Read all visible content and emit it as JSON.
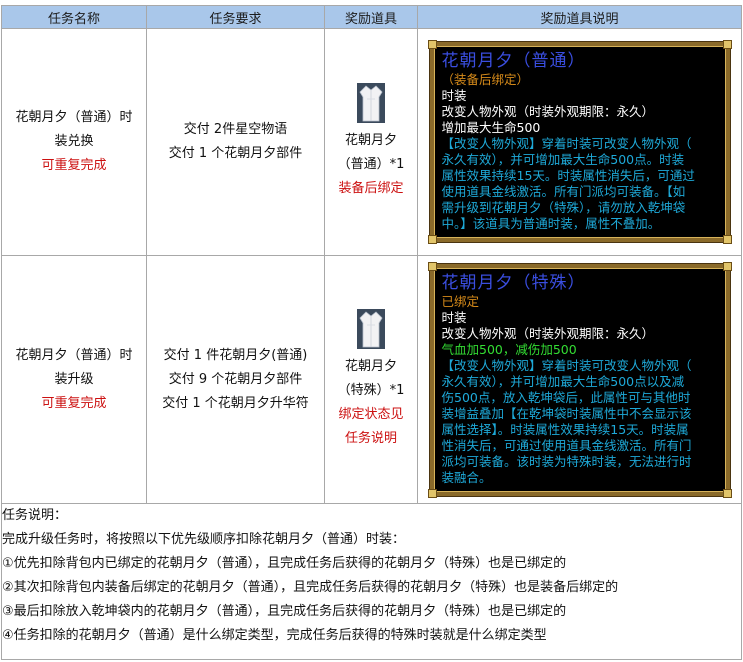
{
  "headers": [
    "任务名称",
    "任务要求",
    "奖励道具",
    "奖励道具说明"
  ],
  "rows": [
    {
      "name_lines": [
        "花朝月夕（普通）时",
        "装兑换"
      ],
      "repeat": "可重复完成",
      "requirements": [
        "交付 2件星空物语",
        "交付 1 个花朝月夕部件"
      ],
      "reward_lines": [
        "花朝月夕",
        "（普通）*1"
      ],
      "reward_bind": "装备后绑定",
      "tooltip": {
        "title": "花朝月夕（普通）",
        "bind": "（装备后绑定）",
        "white_lines": [
          "时装",
          "改变人物外观（时装外观期限：永久）",
          "增加最大生命500"
        ],
        "green_lines": [],
        "desc_lines": [
          "【改变人物外观】穿着时装可改变人物外观（",
          "永久有效），并可增加最大生命500点。时装",
          "属性效果持续15天。时装属性消失后，可通过",
          "使用道具金线激活。所有门派均可装备。【如",
          "需升级到花朝月夕（特殊），请勿放入乾坤袋",
          "中。】该道具为普通时装，属性不叠加。"
        ]
      }
    },
    {
      "name_lines": [
        "花朝月夕（普通）时",
        "装升级"
      ],
      "repeat": "可重复完成",
      "requirements": [
        "交付 1 件花朝月夕(普通)",
        "交付 9 个花朝月夕部件",
        "交付 1 个花朝月夕升华符"
      ],
      "reward_lines": [
        "花朝月夕",
        "（特殊）*1"
      ],
      "reward_bind": "绑定状态见任务说明",
      "reward_bind_lines": [
        "绑定状态见",
        "任务说明"
      ],
      "tooltip": {
        "title": "花朝月夕（特殊）",
        "bind": "已绑定",
        "white_lines": [
          "时装",
          "改变人物外观（时装外观期限：永久）"
        ],
        "green_lines": [
          "气血加500，减伤加500"
        ],
        "desc_lines": [
          "【改变人物外观】穿着时装可改变人物外观（",
          "永久有效），并可增加最大生命500点以及减",
          "伤500点，放入乾坤袋后，此属性可与其他时",
          "装增益叠加【在乾坤袋时装属性中不会显示该",
          "属性选择】。时装属性效果持续15天。时装属",
          "性消失后，可通过使用道具金线激活。所有门",
          "派均可装备。该时装为特殊时装，无法进行时",
          "装融合。"
        ]
      }
    }
  ],
  "note": {
    "title": "任务说明：",
    "lines": [
      "完成升级任务时，将按照以下优先级顺序扣除花朝月夕（普通）时装：",
      "①优先扣除背包内已绑定的花朝月夕（普通），且完成任务后获得的花朝月夕（特殊）也是已绑定的",
      "②其次扣除背包内装备后绑定的花朝月夕（普通），且完成任务后获得的花朝月夕（特殊）也是装备后绑定的",
      "③最后扣除放入乾坤袋内的花朝月夕（普通），且完成任务后获得的花朝月夕（特殊）也是已绑定的",
      "④任务扣除的花朝月夕（普通）是什么绑定类型，完成任务后获得的特殊时装就是什么绑定类型"
    ]
  },
  "colors": {
    "header_bg": "#a9c7ea",
    "red_text": "#cc1111",
    "tooltip_title": "#3a4ee0",
    "tooltip_bind": "#d78b1a",
    "tooltip_green": "#33dd33",
    "tooltip_desc": "#1ea9d8"
  },
  "icons": [
    "robe-icon"
  ]
}
